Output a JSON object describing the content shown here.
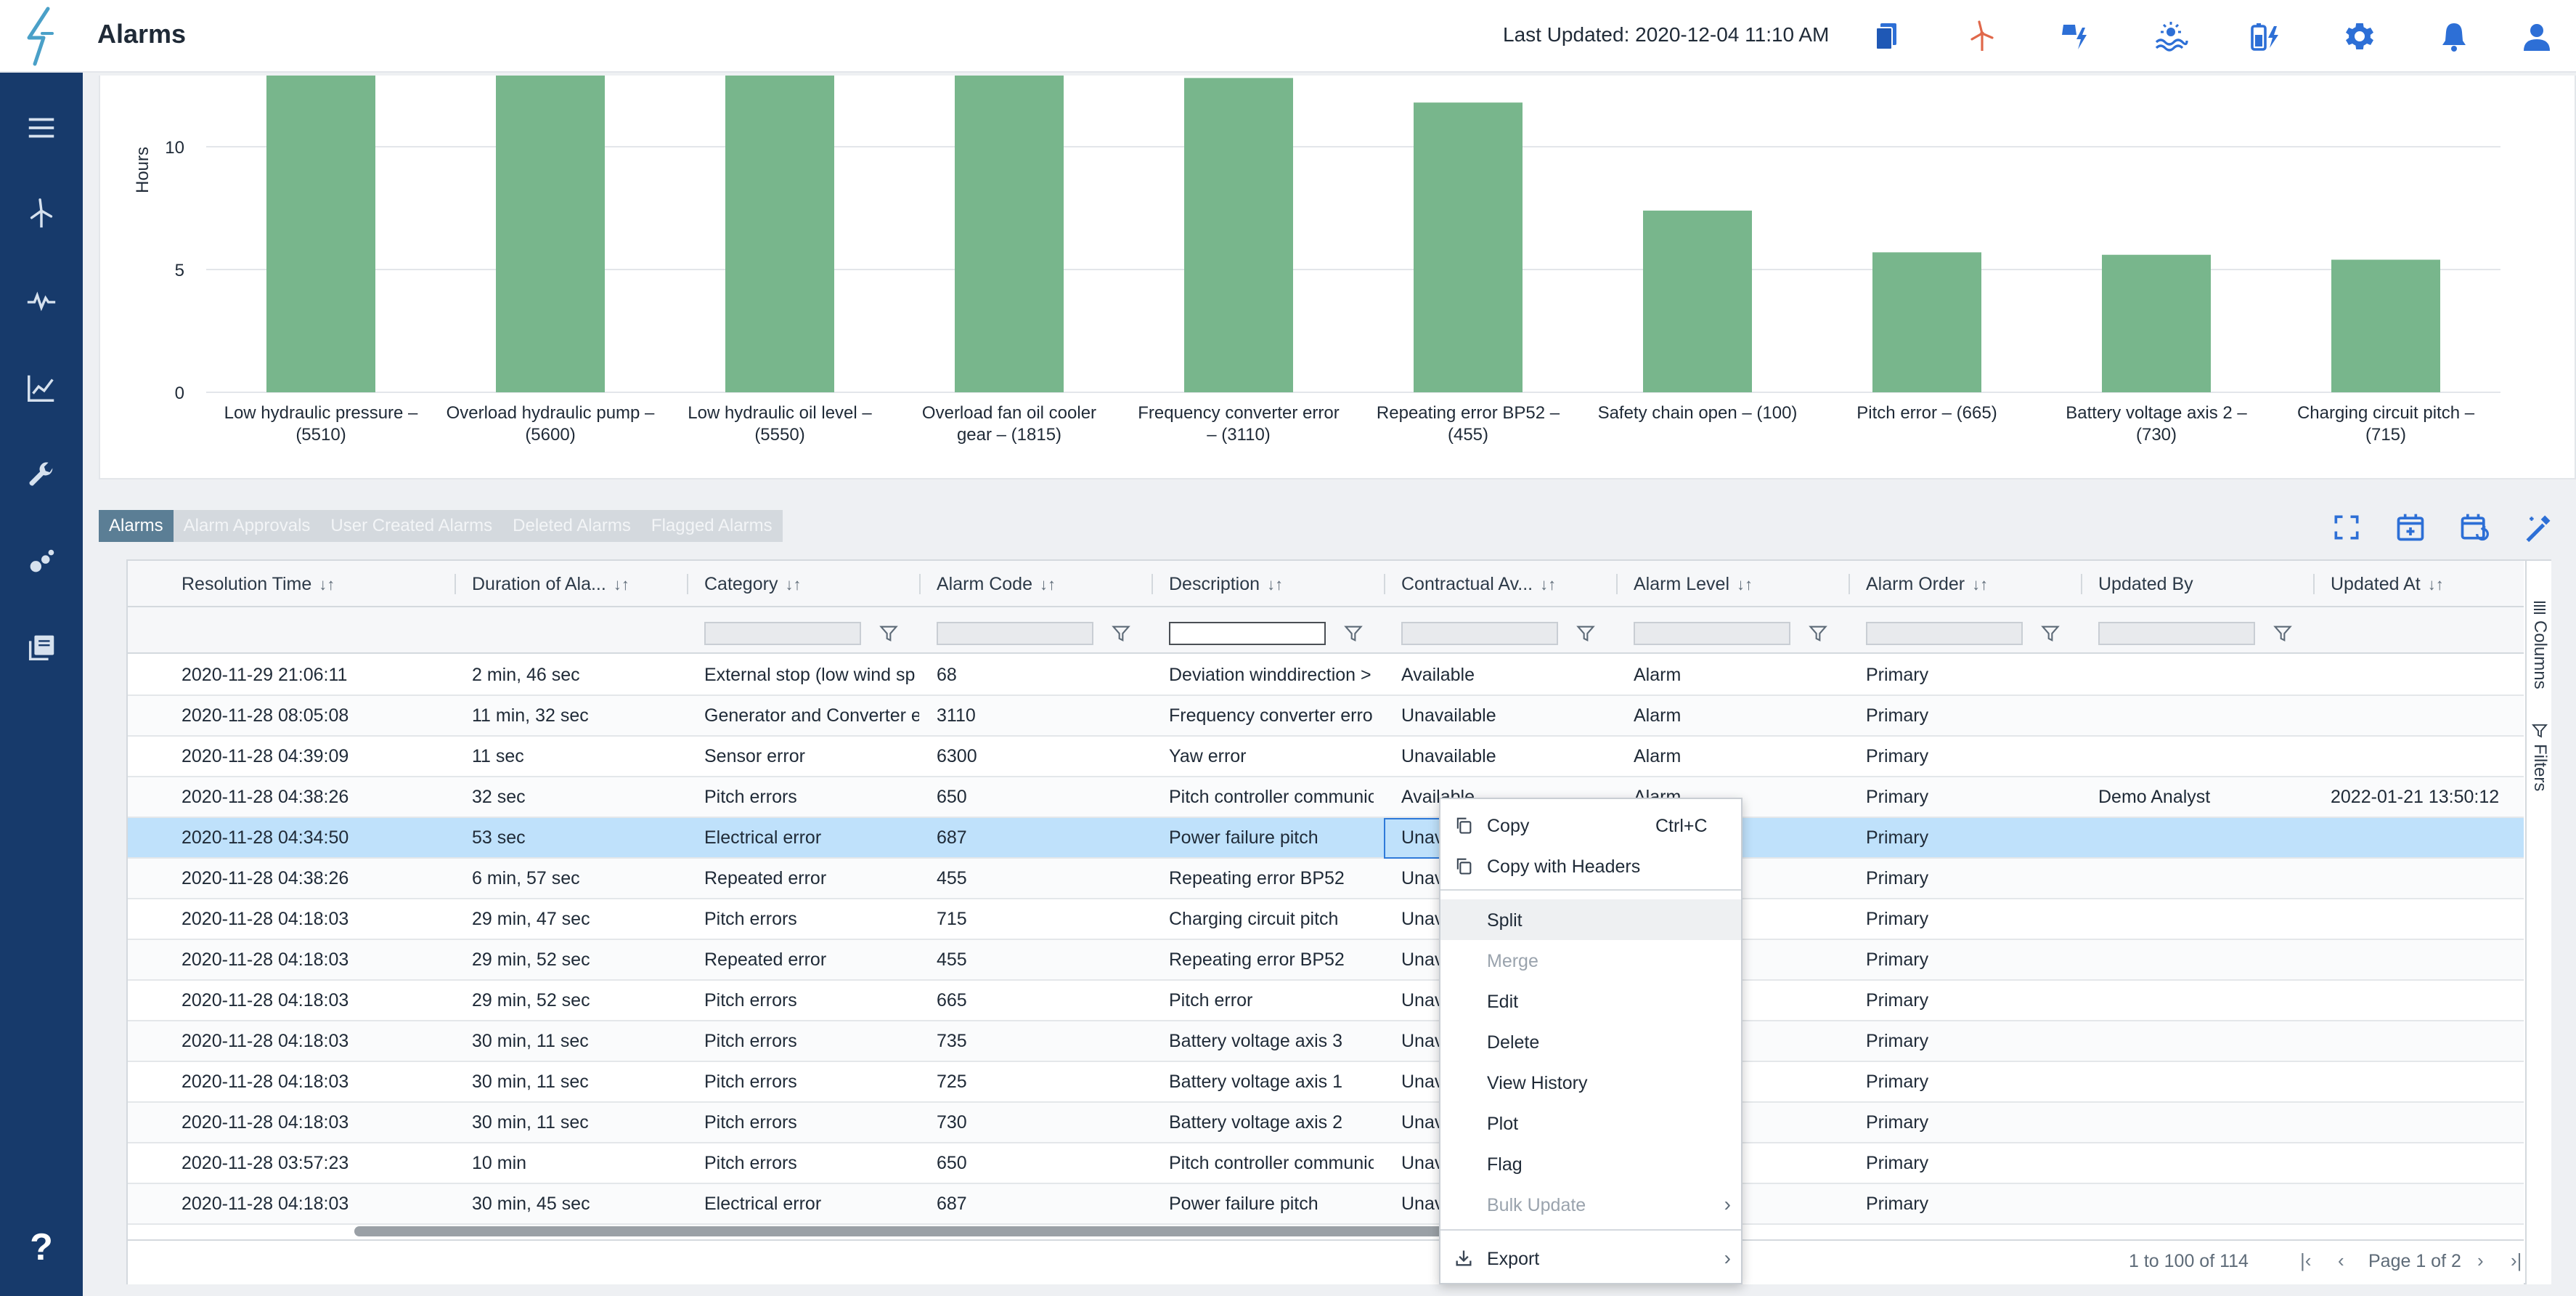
{
  "header": {
    "title": "Alarms",
    "last_updated": "Last Updated: 2020-12-04 11:10 AM",
    "icons": [
      "documents-icon",
      "wind-turbine-icon",
      "solar-power-icon",
      "wave-energy-icon",
      "battery-icon",
      "gear-icon",
      "bell-icon",
      "user-icon"
    ]
  },
  "sidebar": {
    "items": [
      "menu-icon",
      "turbine-icon",
      "pulse-icon",
      "line-chart-icon",
      "wrench-icon",
      "scatter-icon",
      "library-icon"
    ],
    "help_label": "?"
  },
  "chart_data": {
    "type": "bar",
    "title": "",
    "ylabel": "Hours",
    "xlabel": "",
    "ylim": [
      0,
      12.8
    ],
    "yticks": [
      "0",
      "5",
      "10"
    ],
    "categories": [
      [
        "Low hydraulic pressure –",
        "(5510)"
      ],
      [
        "Overload hydraulic pump –",
        "(5600)"
      ],
      [
        "Low hydraulic oil level –",
        "(5550)"
      ],
      [
        "Overload fan oil cooler",
        "gear – (1815)"
      ],
      [
        "Frequency converter error",
        "– (3110)"
      ],
      [
        "Repeating error BP52 –",
        "(455)"
      ],
      [
        "Safety chain open – (100)",
        ""
      ],
      [
        "Pitch error – (665)",
        ""
      ],
      [
        "Battery voltage axis 2 –",
        "(730)"
      ],
      [
        "Charging circuit pitch –",
        "(715)"
      ]
    ],
    "values": [
      13.5,
      13.2,
      13.0,
      12.9,
      12.8,
      11.8,
      7.4,
      5.7,
      5.6,
      5.4
    ],
    "color": "#78b68c"
  },
  "tabs": [
    {
      "label": "Alarms",
      "active": true
    },
    {
      "label": "Alarm Approvals",
      "active": false
    },
    {
      "label": "User Created Alarms",
      "active": false
    },
    {
      "label": "Deleted Alarms",
      "active": false
    },
    {
      "label": "Flagged Alarms",
      "active": false
    }
  ],
  "toolbar_icons": [
    "fullscreen-icon",
    "calendar-add-icon",
    "calendar-refresh-icon",
    "edit-wand-icon"
  ],
  "grid": {
    "columns": [
      {
        "label": "Resolution Time",
        "sort": "↓↑"
      },
      {
        "label": "Duration of Ala...",
        "sort": "↓↑"
      },
      {
        "label": "Category",
        "sort": "↓↑"
      },
      {
        "label": "Alarm Code",
        "sort": "↓↑"
      },
      {
        "label": "Description",
        "sort": "↓↑"
      },
      {
        "label": "Contractual Av...",
        "sort": "↓↑"
      },
      {
        "label": "Alarm Level",
        "sort": "↓↑"
      },
      {
        "label": "Alarm Order",
        "sort": "↓↑"
      },
      {
        "label": "Updated By",
        "sort": ""
      },
      {
        "label": "Updated At",
        "sort": "↓↑"
      }
    ],
    "rows": [
      [
        "2020-11-29 21:06:11",
        "2 min, 46 sec",
        "External stop (low wind sp",
        "68",
        "Deviation winddirection >",
        "Available",
        "Alarm",
        "Primary",
        "",
        ""
      ],
      [
        "2020-11-28 08:05:08",
        "11 min, 32 sec",
        "Generator and Converter e",
        "3110",
        "Frequency converter error",
        "Unavailable",
        "Alarm",
        "Primary",
        "",
        ""
      ],
      [
        "2020-11-28 04:39:09",
        "11 sec",
        "Sensor error",
        "6300",
        "Yaw error",
        "Unavailable",
        "Alarm",
        "Primary",
        "",
        ""
      ],
      [
        "2020-11-28 04:38:26",
        "32 sec",
        "Pitch errors",
        "650",
        "Pitch controller communic",
        "Available",
        "Alarm",
        "Primary",
        "Demo Analyst",
        "2022-01-21 13:50:12"
      ],
      [
        "2020-11-28 04:34:50",
        "53 sec",
        "Electrical error",
        "687",
        "Power failure pitch",
        "Unav",
        "",
        "Primary",
        "",
        ""
      ],
      [
        "2020-11-28 04:38:26",
        "6 min, 57 sec",
        "Repeated error",
        "455",
        "Repeating error BP52",
        "Unav",
        "",
        "Primary",
        "",
        ""
      ],
      [
        "2020-11-28 04:18:03",
        "29 min, 47 sec",
        "Pitch errors",
        "715",
        "Charging circuit pitch",
        "Unav",
        "",
        "Primary",
        "",
        ""
      ],
      [
        "2020-11-28 04:18:03",
        "29 min, 52 sec",
        "Repeated error",
        "455",
        "Repeating error BP52",
        "Unav",
        "",
        "Primary",
        "",
        ""
      ],
      [
        "2020-11-28 04:18:03",
        "29 min, 52 sec",
        "Pitch errors",
        "665",
        "Pitch error",
        "Unav",
        "",
        "Primary",
        "",
        ""
      ],
      [
        "2020-11-28 04:18:03",
        "30 min, 11 sec",
        "Pitch errors",
        "735",
        "Battery voltage axis 3",
        "Unav",
        "",
        "Primary",
        "",
        ""
      ],
      [
        "2020-11-28 04:18:03",
        "30 min, 11 sec",
        "Pitch errors",
        "725",
        "Battery voltage axis 1",
        "Unav",
        "",
        "Primary",
        "",
        ""
      ],
      [
        "2020-11-28 04:18:03",
        "30 min, 11 sec",
        "Pitch errors",
        "730",
        "Battery voltage axis 2",
        "Unav",
        "",
        "Primary",
        "",
        ""
      ],
      [
        "2020-11-28 03:57:23",
        "10 min",
        "Pitch errors",
        "650",
        "Pitch controller communic",
        "Unav",
        "",
        "Primary",
        "",
        ""
      ],
      [
        "2020-11-28 04:18:03",
        "30 min, 45 sec",
        "Electrical error",
        "687",
        "Power failure pitch",
        "Unav",
        "",
        "Primary",
        "",
        ""
      ]
    ],
    "selected_row": 4,
    "pagination": {
      "summary": "1 to 100 of 114",
      "page": "Page 1 of 2"
    },
    "side_panel": {
      "columns": "Columns",
      "filters": "Filters"
    }
  },
  "context_menu": {
    "items": [
      {
        "label": "Copy",
        "shortcut": "Ctrl+C",
        "icon": "copy-icon"
      },
      {
        "label": "Copy with Headers",
        "icon": "copy-icon"
      },
      {
        "label": "Split",
        "hover": true
      },
      {
        "label": "Merge",
        "disabled": true
      },
      {
        "label": "Edit"
      },
      {
        "label": "Delete"
      },
      {
        "label": "View History"
      },
      {
        "label": "Plot"
      },
      {
        "label": "Flag"
      },
      {
        "label": "Bulk Update",
        "disabled": true,
        "submenu": true
      },
      {
        "label": "Export",
        "submenu": true,
        "icon": "download-icon"
      }
    ]
  }
}
